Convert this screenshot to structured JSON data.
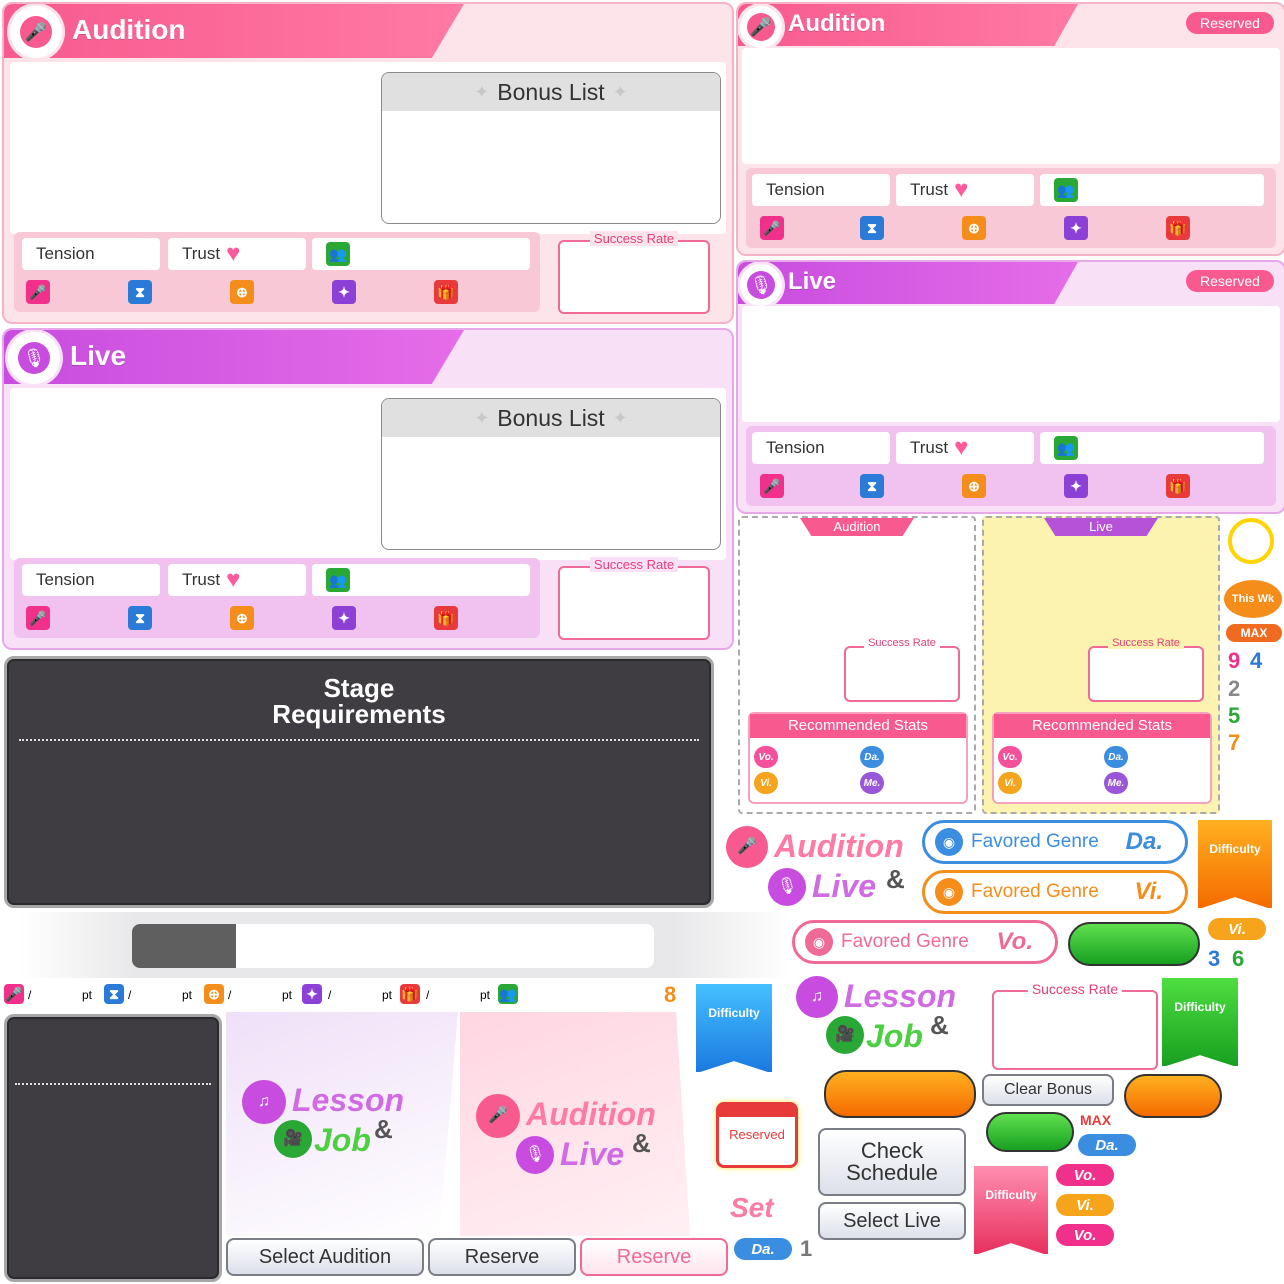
{
  "audition_panel": {
    "title": "Audition",
    "bonus_title": "Bonus List",
    "tension": "Tension",
    "trust": "Trust",
    "success_rate": "Success Rate"
  },
  "live_panel": {
    "title": "Live",
    "bonus_title": "Bonus List",
    "tension": "Tension",
    "trust": "Trust",
    "success_rate": "Success Rate"
  },
  "audition_small": {
    "title": "Audition",
    "reserved": "Reserved",
    "tension": "Tension",
    "trust": "Trust"
  },
  "live_small": {
    "title": "Live",
    "reserved": "Reserved",
    "tension": "Tension",
    "trust": "Trust"
  },
  "stage": {
    "title_line1": "Stage",
    "title_line2": "Requirements"
  },
  "cards": {
    "audition": {
      "tab": "Audition",
      "success_rate": "Success Rate",
      "recommended": "Recommended Stats",
      "vo": "Vo.",
      "da": "Da.",
      "vi": "Vi.",
      "me": "Me."
    },
    "live": {
      "tab": "Live",
      "success_rate": "Success Rate",
      "recommended": "Recommended Stats",
      "vo": "Vo.",
      "da": "Da.",
      "vi": "Vi.",
      "me": "Me."
    }
  },
  "side": {
    "this_week": "This Wk",
    "max": "MAX",
    "n9": "9",
    "n4": "4",
    "n2": "2",
    "n5": "5",
    "n7": "7",
    "n3": "3",
    "n6": "6",
    "n8": "8",
    "n1": "1"
  },
  "logos": {
    "audition": "Audition",
    "live": "Live",
    "amp": "&",
    "lesson": "Lesson",
    "job": "Job"
  },
  "favored": {
    "label": "Favored Genre",
    "da": "Da.",
    "vi": "Vi.",
    "vo": "Vo."
  },
  "difficulty": "Difficulty",
  "pt_row": {
    "slash": "/",
    "pt": "pt"
  },
  "buttons": {
    "select_audition": "Select Audition",
    "reserve": "Reserve",
    "reserve_pink": "Reserve",
    "clear_bonus": "Clear Bonus",
    "check_schedule_1": "Check",
    "check_schedule_2": "Schedule",
    "select_live": "Select Live"
  },
  "misc": {
    "reserved_calendar": "Reserved",
    "set": "Set",
    "success_rate": "Success Rate",
    "max": "MAX",
    "da": "Da.",
    "vo": "Vo.",
    "vi": "Vi."
  }
}
